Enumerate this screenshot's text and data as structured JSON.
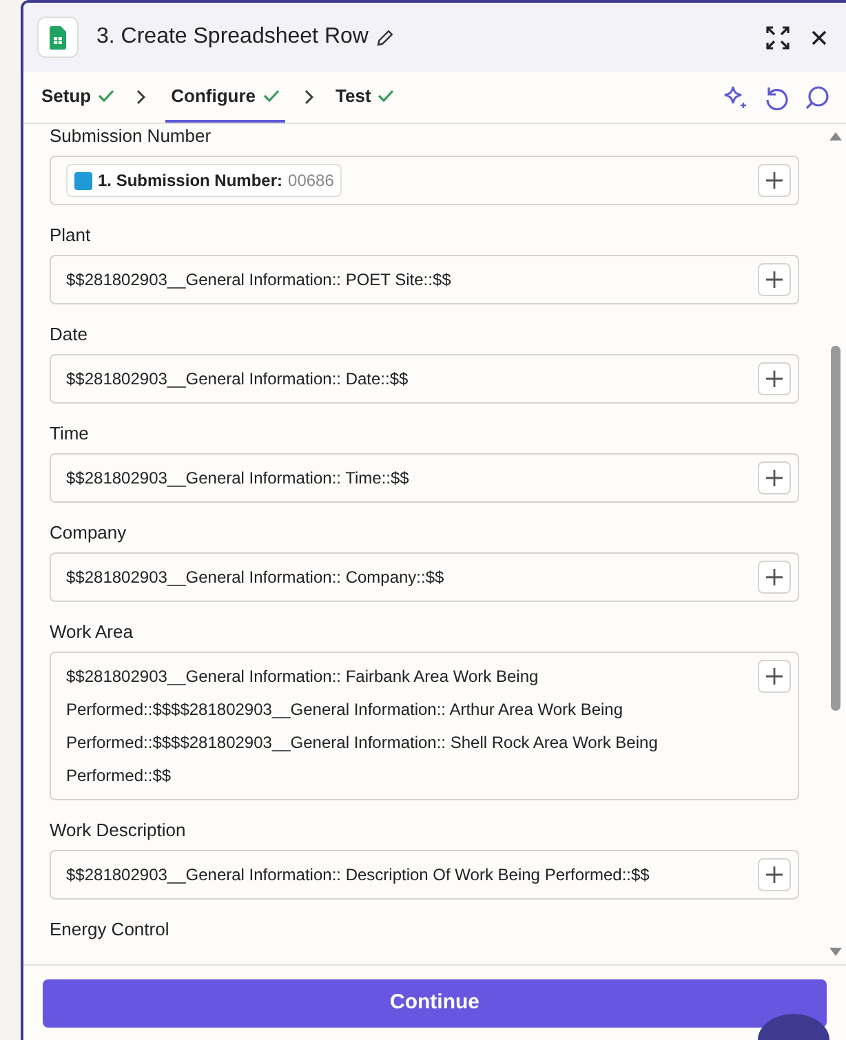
{
  "header": {
    "title": "3. Create Spreadsheet Row"
  },
  "steps": [
    {
      "label": "Setup",
      "done": true,
      "selected": false
    },
    {
      "label": "Configure",
      "done": true,
      "selected": true
    },
    {
      "label": "Test",
      "done": true,
      "selected": false
    }
  ],
  "fields": [
    {
      "label": "Submission Number",
      "kind": "token",
      "token_label": "1. Submission Number:",
      "token_value": "00686"
    },
    {
      "label": "Plant",
      "kind": "text",
      "value": "$$281802903__General Information:: POET Site::$$"
    },
    {
      "label": "Date",
      "kind": "text",
      "value": "$$281802903__General Information:: Date::$$"
    },
    {
      "label": "Time",
      "kind": "text",
      "value": "$$281802903__General Information:: Time::$$"
    },
    {
      "label": "Company",
      "kind": "text",
      "value": "$$281802903__General Information:: Company::$$"
    },
    {
      "label": "Work Area",
      "kind": "text",
      "value": "$$281802903__General Information:: Fairbank Area Work Being Performed::$$$$281802903__General Information:: Arthur Area Work Being Performed::$$$$281802903__General Information:: Shell Rock Area Work Being Performed::$$"
    },
    {
      "label": "Work Description",
      "kind": "text",
      "value": "$$281802903__General Information:: Description Of Work Being Performed::$$"
    },
    {
      "label": "Energy Control",
      "kind": "label_only"
    }
  ],
  "footer": {
    "button": "Continue"
  }
}
